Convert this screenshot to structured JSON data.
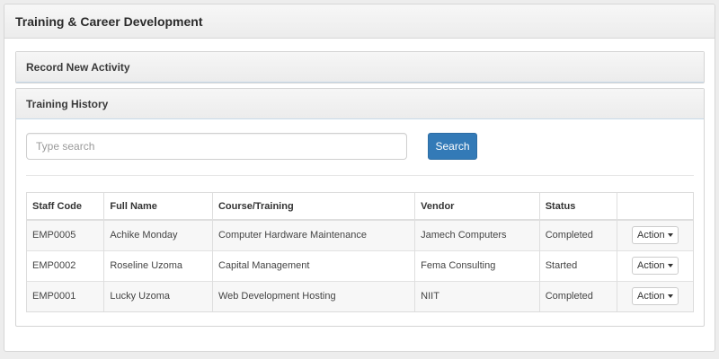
{
  "page": {
    "title": "Training & Career Development"
  },
  "record_panel": {
    "title": "Record New Activity"
  },
  "history_panel": {
    "title": "Training History",
    "search": {
      "placeholder": "Type search",
      "value": "",
      "button_label": "Search"
    },
    "table": {
      "headers": [
        "Staff Code",
        "Full Name",
        "Course/Training",
        "Vendor",
        "Status",
        ""
      ],
      "rows": [
        {
          "staff_code": "EMP0005",
          "full_name": "Achike Monday",
          "course": "Computer Hardware Maintenance",
          "vendor": "Jamech Computers",
          "status": "Completed",
          "action_label": "Action"
        },
        {
          "staff_code": "EMP0002",
          "full_name": "Roseline Uzoma",
          "course": "Capital Management",
          "vendor": "Fema Consulting",
          "status": "Started",
          "action_label": "Action"
        },
        {
          "staff_code": "EMP0001",
          "full_name": "Lucky Uzoma",
          "course": "Web Development Hosting",
          "vendor": "NIIT",
          "status": "Completed",
          "action_label": "Action"
        }
      ]
    }
  },
  "colors": {
    "primary_button": "#337ab7",
    "header_background": "#f2f2f2",
    "page_background": "#ededed"
  },
  "icons": {
    "dropdown": "caret-down-icon"
  }
}
